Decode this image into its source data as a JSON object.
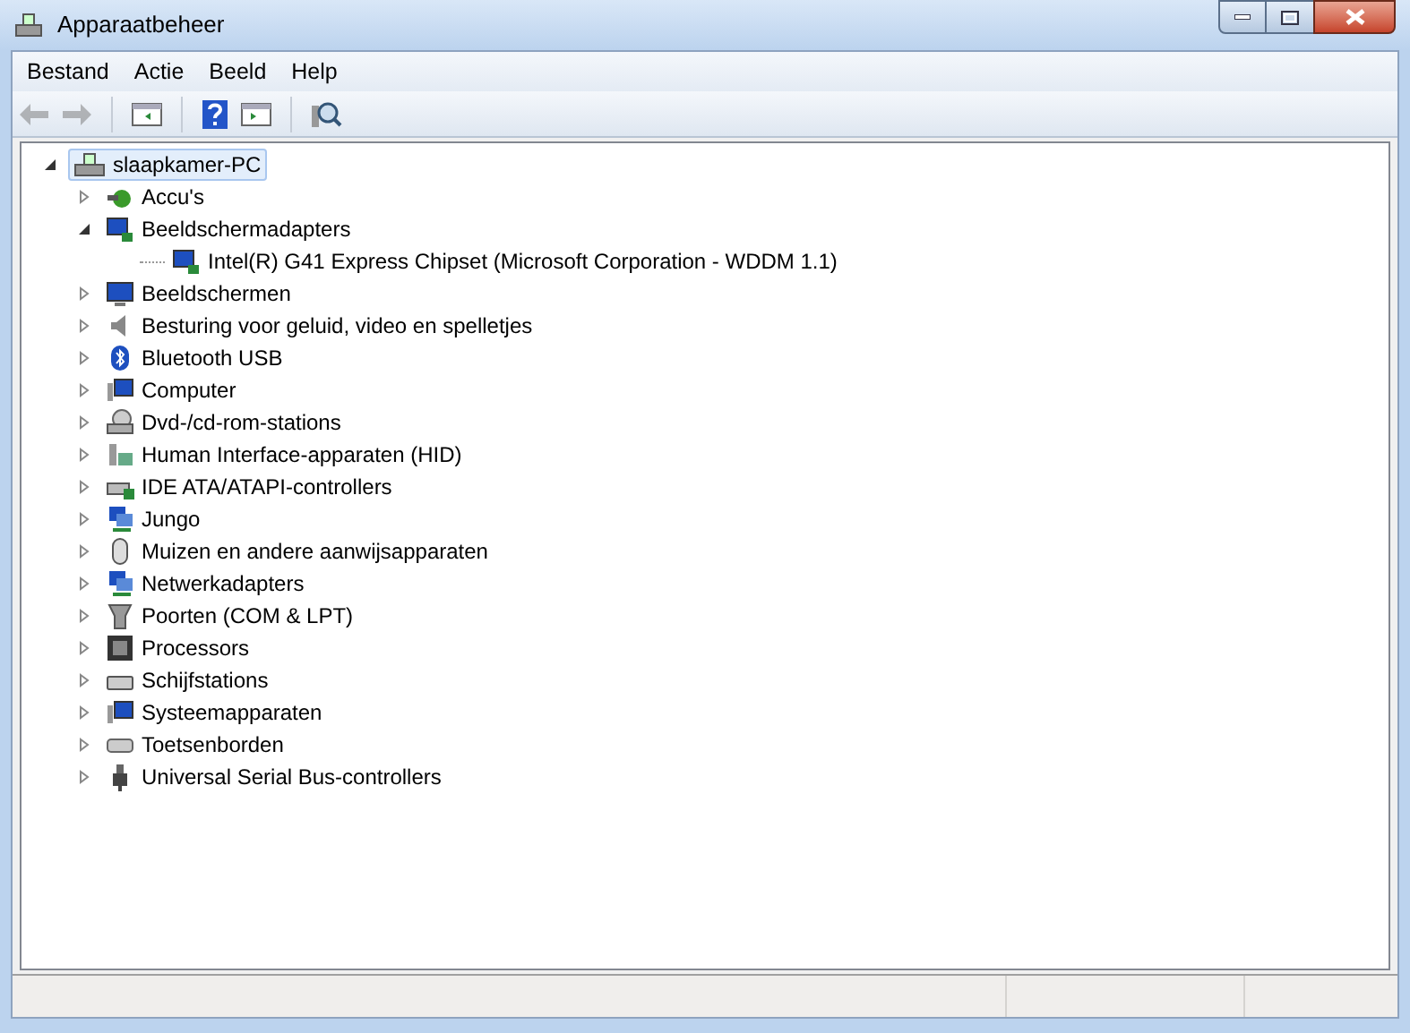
{
  "window": {
    "title": "Apparaatbeheer"
  },
  "menu": [
    "Bestand",
    "Actie",
    "Beeld",
    "Help"
  ],
  "toolbar": [
    {
      "kind": "back",
      "disabled": true
    },
    {
      "kind": "forward",
      "disabled": true
    },
    {
      "kind": "sep"
    },
    {
      "kind": "panel",
      "disabled": false
    },
    {
      "kind": "sep"
    },
    {
      "kind": "help",
      "disabled": false
    },
    {
      "kind": "panel2",
      "disabled": false
    },
    {
      "kind": "sep"
    },
    {
      "kind": "scan",
      "disabled": false
    }
  ],
  "tree": {
    "label": "slaapkamer-PC",
    "expanded": true,
    "selected": true,
    "children": [
      {
        "label": "Accu's",
        "expanded": false
      },
      {
        "label": "Beeldschermadapters",
        "expanded": true,
        "children": [
          {
            "label": "Intel(R) G41 Express Chipset (Microsoft Corporation - WDDM 1.1)"
          }
        ]
      },
      {
        "label": "Beeldschermen",
        "expanded": false
      },
      {
        "label": "Besturing voor geluid, video en spelletjes",
        "expanded": false
      },
      {
        "label": "Bluetooth USB",
        "expanded": false
      },
      {
        "label": "Computer",
        "expanded": false
      },
      {
        "label": "Dvd-/cd-rom-stations",
        "expanded": false
      },
      {
        "label": "Human Interface-apparaten (HID)",
        "expanded": false
      },
      {
        "label": "IDE ATA/ATAPI-controllers",
        "expanded": false
      },
      {
        "label": "Jungo",
        "expanded": false
      },
      {
        "label": "Muizen en andere aanwijsapparaten",
        "expanded": false
      },
      {
        "label": "Netwerkadapters",
        "expanded": false
      },
      {
        "label": "Poorten (COM & LPT)",
        "expanded": false
      },
      {
        "label": "Processors",
        "expanded": false
      },
      {
        "label": "Schijfstations",
        "expanded": false
      },
      {
        "label": "Systeemapparaten",
        "expanded": false
      },
      {
        "label": "Toetsenborden",
        "expanded": false
      },
      {
        "label": "Universal Serial Bus-controllers",
        "expanded": false
      }
    ]
  }
}
